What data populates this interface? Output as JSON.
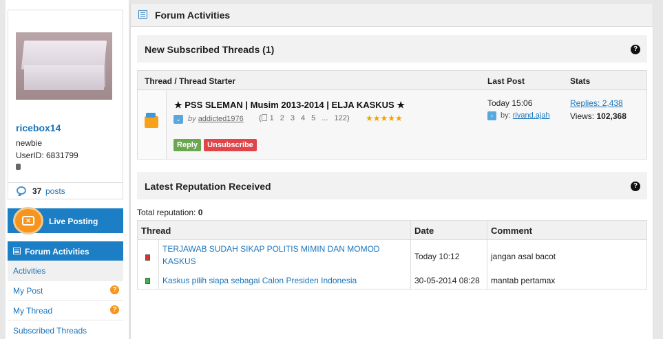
{
  "profile": {
    "username": "ricebox14",
    "rank": "newbie",
    "user_id": "UserID: 6831799",
    "post_count": "37",
    "posts_label": "posts"
  },
  "sidebar": {
    "live_posting": "Live Posting",
    "forum_activities": "Forum Activities",
    "items": [
      {
        "label": "Activities",
        "active": true
      },
      {
        "label": "My Post",
        "help": "?"
      },
      {
        "label": "My Thread",
        "help": "?"
      },
      {
        "label": "Subscribed Threads"
      }
    ]
  },
  "main": {
    "title": "Forum Activities",
    "subscribed": {
      "title": "New Subscribed Threads (1)",
      "help": "?",
      "columns": [
        "Thread / Thread Starter",
        "Last Post",
        "Stats"
      ],
      "thread": {
        "title": "★ PSS SLEMAN | Musim 2013-2014 | ELJA KASKUS ★",
        "by_prefix": "by",
        "starter": "addicted1976",
        "pages": [
          "1",
          "2",
          "3",
          "4",
          "5",
          "...",
          "122"
        ],
        "stars": "★★★★★",
        "reply_label": "Reply",
        "unsubscribe_label": "Unsubscribe",
        "last_post_time": "Today 15:06",
        "last_post_by_prefix": "by:",
        "last_post_by": "rivand.ajah",
        "replies": "Replies: 2,438",
        "views_label": "Views:",
        "views_value": "102,368"
      }
    },
    "reputation": {
      "title": "Latest Reputation Received",
      "help": "?",
      "total_label": "Total reputation:",
      "total_value": "0",
      "columns": [
        "Thread",
        "Date",
        "Comment"
      ],
      "rows": [
        {
          "thread": "TERJAWAB SUDAH SIKAP POLITIS MIMIN DAN MOMOD KASKUS",
          "date": "Today 10:12",
          "comment": "jangan asal bacot",
          "color": "#d9342b"
        },
        {
          "thread": "Kaskus pilih siapa sebagai Calon Presiden Indonesia",
          "date": "30-05-2014 08:28",
          "comment": "mantab pertamax",
          "color": "#3fb34f"
        }
      ]
    }
  }
}
